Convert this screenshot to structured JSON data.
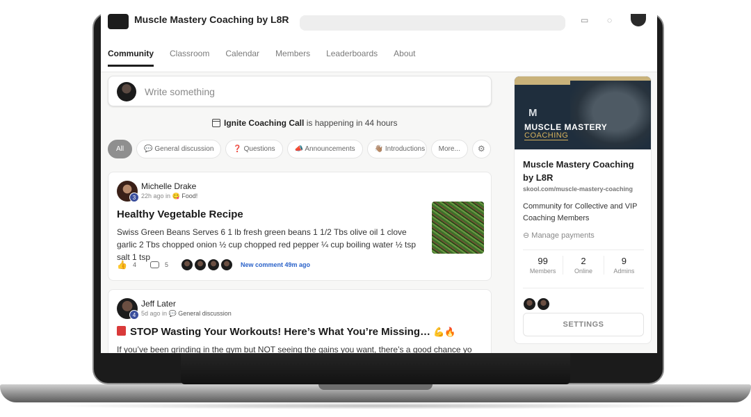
{
  "header": {
    "group_name": "Muscle Mastery Coaching by L8R"
  },
  "tabs": [
    {
      "label": "Community"
    },
    {
      "label": "Classroom"
    },
    {
      "label": "Calendar"
    },
    {
      "label": "Members"
    },
    {
      "label": "Leaderboards"
    },
    {
      "label": "About"
    }
  ],
  "composer": {
    "placeholder": "Write something"
  },
  "event": {
    "name": "Ignite Coaching Call",
    "suffix": "is happening in 44 hours"
  },
  "filters": [
    {
      "label": "All"
    },
    {
      "label": "💬 General discussion"
    },
    {
      "label": "❓ Questions"
    },
    {
      "label": "📣 Announcements"
    },
    {
      "label": "👋🏽 Introductions"
    },
    {
      "label": "More..."
    }
  ],
  "posts": [
    {
      "author": "Michelle Drake",
      "level": "3",
      "time": "22h ago in",
      "category": "😋 Food!",
      "title": "Healthy Vegetable Recipe",
      "body": "Swiss Green Beans Serves 6 1 lb fresh green beans 1 1/2 Tbs olive oil 1 clove garlic 2 Tbs chopped onion ½ cup chopped red pepper ¼ cup boiling water ½ tsp salt 1 tsp",
      "likes": "4",
      "comments": "5",
      "new_comment": "New comment 49m ago"
    },
    {
      "author": "Jeff Later",
      "level": "4",
      "time": "5d ago in",
      "category": "💬 General discussion",
      "title": "STOP Wasting Your Workouts! Here’s What You’re Missing…",
      "title_emoji": "💪🔥",
      "body": "If you’ve been grinding in the gym but NOT seeing the gains you want, there’s a good chance you’re"
    }
  ],
  "sidebar": {
    "banner_title": "MUSCLE MASTERY",
    "banner_sub": "COACHING",
    "name": "Muscle Mastery Coaching by L8R",
    "url": "skool.com/muscle-mastery-coaching",
    "description": "Community for Collective and VIP Coaching Members",
    "manage_payments": "Manage payments",
    "stats": [
      {
        "value": "99",
        "label": "Members"
      },
      {
        "value": "2",
        "label": "Online"
      },
      {
        "value": "9",
        "label": "Admins"
      }
    ],
    "settings_label": "SETTINGS"
  },
  "icons": [
    "calendar-icon",
    "like-icon",
    "comment-icon",
    "filter-settings-icon",
    "link-icon",
    "search-icon",
    "chat-icon",
    "bell-icon"
  ]
}
